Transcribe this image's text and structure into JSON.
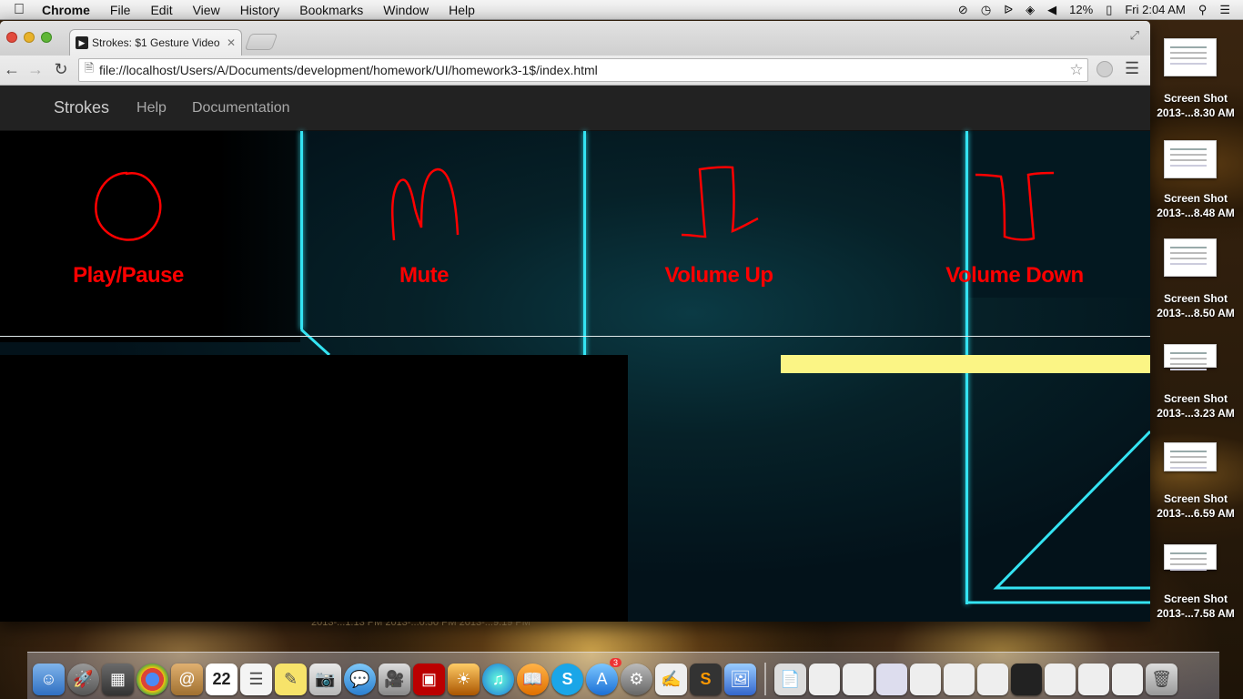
{
  "menubar": {
    "apple": "",
    "items": [
      "Chrome",
      "File",
      "Edit",
      "View",
      "History",
      "Bookmarks",
      "Window",
      "Help"
    ],
    "battery": "12%",
    "clock": "Fri 2:04 AM"
  },
  "browser": {
    "tab_title": "Strokes: $1 Gesture Video",
    "url": "file://localhost/Users/A/Documents/development/homework/UI/homework3-1$/index.html"
  },
  "page": {
    "navbar": {
      "brand": "Strokes",
      "links": [
        "Help",
        "Documentation"
      ]
    },
    "gestures": [
      {
        "label": "Play/Pause",
        "shape": "circle"
      },
      {
        "label": "Mute",
        "shape": "m"
      },
      {
        "label": "Volume Up",
        "shape": "step-up"
      },
      {
        "label": "Volume Down",
        "shape": "step-down"
      }
    ],
    "colors": {
      "gesture_red": "#ff0000",
      "neon_cyan": "#34e3f2",
      "progress_yellow": "#fbf585"
    }
  },
  "desktop": {
    "screenshots": [
      {
        "line1": "Screen Shot",
        "line2": "2013-...8.30 AM"
      },
      {
        "line1": "Screen Shot",
        "line2": "2013-...8.48 AM"
      },
      {
        "line1": "Screen Shot",
        "line2": "2013-...8.50 AM"
      },
      {
        "line1": "Screen Shot",
        "line2": "2013-...3.23 AM"
      },
      {
        "line1": "Screen Shot",
        "line2": "2013-...6.59 AM"
      },
      {
        "line1": "Screen Shot",
        "line2": "2013-...7.58 AM"
      }
    ],
    "background_labels": "2013-...1.13 PM    2013-...0.50 PM    2013-...9.19 PM"
  },
  "dock": {
    "calendar_day": "22",
    "appstore_badge": "3"
  }
}
